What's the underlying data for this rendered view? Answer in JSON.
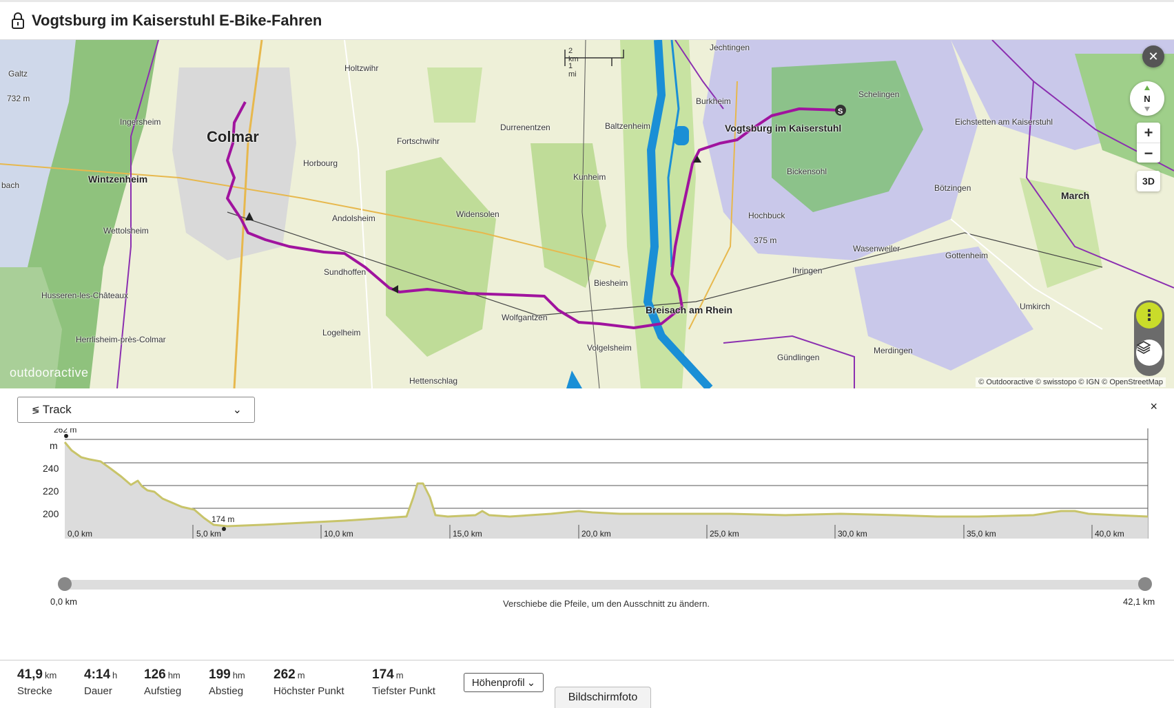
{
  "header": {
    "title": "Vogtsburg im Kaiserstuhl E-Bike-Fahren"
  },
  "map": {
    "places": {
      "colmar": "Colmar",
      "breisach": "Breisach am Rhein",
      "vogtsburg": "Vogtsburg im Kaiserstuhl",
      "march": "March",
      "wintzenheim": "Wintzenheim",
      "ingersheim": "Ingersheim",
      "horbourg": "Horbourg",
      "holtzwihr": "Holtzwihr",
      "fortschwihr": "Fortschwihr",
      "durrenentzen": "Durrenentzen",
      "baltzenheim": "Baltzenheim",
      "kunheim": "Kunheim",
      "andolsheim": "Andolsheim",
      "widensolen": "Widensolen",
      "sundhoffen": "Sundhoffen",
      "wettolsheim": "Wettolsheim",
      "husseren": "Husseren-les-Châteaux",
      "herrlisheim": "Herrlisheim-près-Colmar",
      "logelheim": "Logelheim",
      "wolfgantzen": "Wolfgantzen",
      "volgelsheim": "Volgelsheim",
      "biesheim": "Biesheim",
      "hettenschlag": "Hettenschlag",
      "jechtingen": "Jechtingen",
      "burkheim": "Burkheim",
      "schelingen": "Schelingen",
      "eichstetten": "Eichstetten am Kaiserstuhl",
      "bickensohl": "Bickensohl",
      "botzingen": "Bötzingen",
      "hochbuck": "Hochbuck",
      "hochbuck_elev": "375 m",
      "wasenweiler": "Wasenweiler",
      "ihringen": "Ihringen",
      "gottenheim": "Gottenheim",
      "umkirch": "Umkirch",
      "merdingen": "Merdingen",
      "gundlingen": "Gündlingen",
      "galtz": "Galtz",
      "galtz_elev": "732 m",
      "bach": "bach"
    },
    "scale_km": "2 km",
    "scale_mi": "1 mi",
    "brand": "outdooractive",
    "attribution": "© Outdooractive © swisstopo © IGN © OpenStreetMap",
    "compass_label": "N",
    "zoom_in": "+",
    "zoom_out": "−",
    "btn_3d": "3D",
    "close_symbol": "✕",
    "more_symbol": "⋮"
  },
  "panel": {
    "dropdown_value": "Track",
    "close_symbol": "×",
    "profile": {
      "y_unit": "m",
      "y_ticks": [
        "240",
        "220",
        "200"
      ],
      "x_ticks": [
        "0,0 km",
        "5,0 km",
        "10,0 km",
        "15,0 km",
        "20,0 km",
        "25,0 km",
        "30,0 km",
        "35,0 km",
        "40,0 km"
      ],
      "max_label": "262 m",
      "min_label": "174 m"
    },
    "slider": {
      "start": "0,0 km",
      "end": "42,1 km",
      "hint": "Verschiebe die Pfeile, um den Ausschnitt zu ändern."
    }
  },
  "stats": [
    {
      "value": "41,9",
      "unit": "km",
      "label": "Strecke"
    },
    {
      "value": "4:14",
      "unit": "h",
      "label": "Dauer"
    },
    {
      "value": "126",
      "unit": "hm",
      "label": "Aufstieg"
    },
    {
      "value": "199",
      "unit": "hm",
      "label": "Abstieg"
    },
    {
      "value": "262",
      "unit": "m",
      "label": "Höchster Punkt"
    },
    {
      "value": "174",
      "unit": "m",
      "label": "Tiefster Punkt"
    }
  ],
  "profile_button": "Höhenprofil",
  "screenshot_tab": "Bildschirmfoto",
  "colors": {
    "route": "#a0139e",
    "river": "#1a8fd6",
    "profile_line": "#c8c46a",
    "profile_fill": "#dcdcdc",
    "accent": "#c9dc2a"
  }
}
